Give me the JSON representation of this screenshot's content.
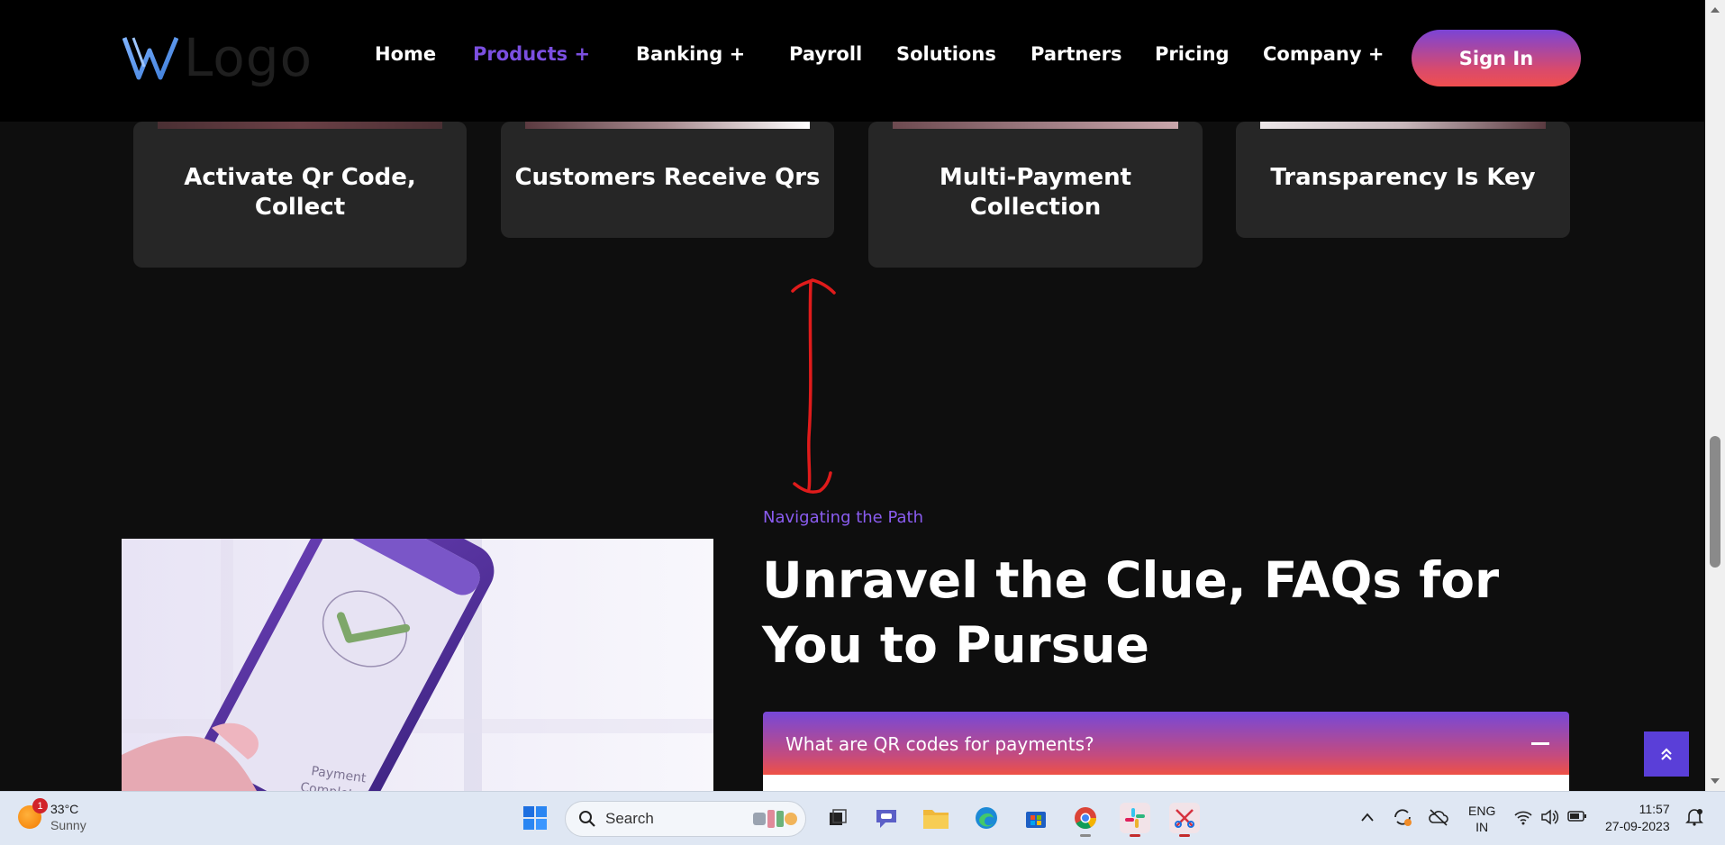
{
  "header": {
    "logo_text": "Logo",
    "nav": [
      {
        "label": "Home",
        "active": false
      },
      {
        "label": "Products +",
        "active": true
      },
      {
        "label": "Banking +",
        "active": false
      },
      {
        "label": "Payroll",
        "active": false
      },
      {
        "label": "Solutions",
        "active": false
      },
      {
        "label": "Partners",
        "active": false
      },
      {
        "label": "Pricing",
        "active": false
      },
      {
        "label": "Company +",
        "active": false
      }
    ],
    "signin_label": "Sign In"
  },
  "cards": [
    {
      "title": "Activate Qr Code, Collect"
    },
    {
      "title": "Customers Receive Qrs"
    },
    {
      "title": "Multi-Payment Collection"
    },
    {
      "title": "Transparency Is Key"
    }
  ],
  "faq": {
    "eyebrow": "Navigating the Path",
    "title": "Unravel the Clue, FAQs for You to Pursue",
    "image_caption": "Payment Completed",
    "question": "What are QR codes for payments?"
  },
  "taskbar": {
    "weather": {
      "temp": "33°C",
      "condition": "Sunny",
      "badge": "1"
    },
    "search_placeholder": "Search",
    "lang_line1": "ENG",
    "lang_line2": "IN",
    "time": "11:57",
    "date": "27-09-2023"
  },
  "colors": {
    "accent": "#7b4fe0",
    "gradient_top": "#7648d8",
    "gradient_bottom": "#ef5145",
    "card_bg": "#262626",
    "page_bg": "#0e0e0e"
  }
}
